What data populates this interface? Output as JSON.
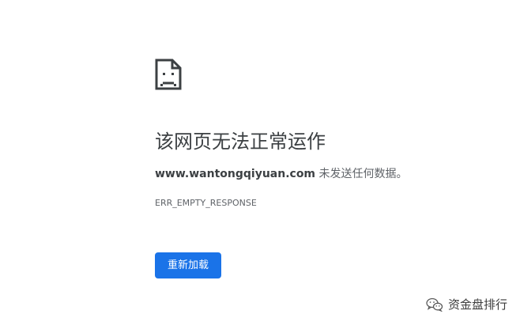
{
  "page": {
    "icon": "sad-document-icon",
    "title": "该网页无法正常运作",
    "host": "www.wantongqiyuan.com",
    "message_suffix": " 未发送任何数据。",
    "error_code": "ERR_EMPTY_RESPONSE",
    "reload_label": "重新加载"
  },
  "watermark": {
    "icon": "wechat-icon",
    "text": "资金盘排行"
  },
  "colors": {
    "accent": "#1a73e8",
    "text": "#3c4043",
    "secondary_text": "#5f6368"
  }
}
